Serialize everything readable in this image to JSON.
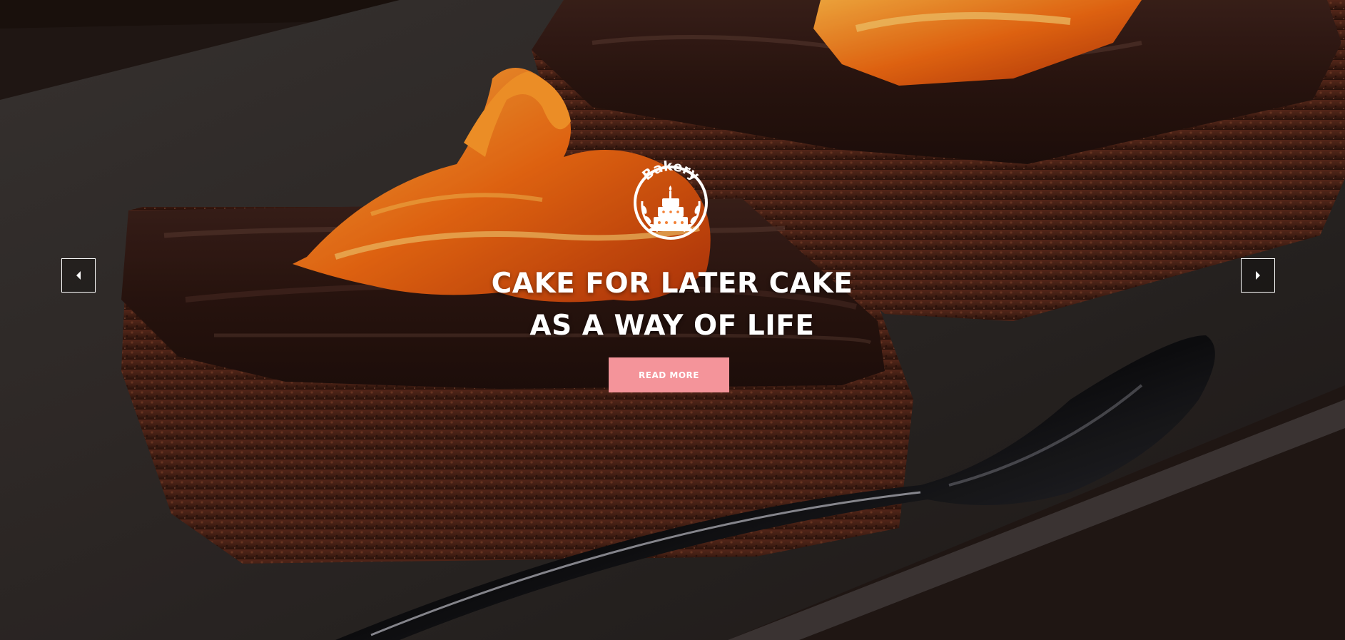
{
  "slider": {
    "logo_text": "Bakery",
    "headline_line1": "CAKE FOR LATER CAKE",
    "headline_line2": "AS A WAY OF LIFE",
    "button_label": "READ MORE",
    "prev_icon": "caret-left-icon",
    "next_icon": "caret-right-icon"
  },
  "colors": {
    "button_bg": "#f4949a",
    "headline": "#ffffff",
    "arrow_border": "#ffffff",
    "glaze": "#f06a12",
    "chocolate": "#2a1510",
    "plate": "#2e2827"
  }
}
